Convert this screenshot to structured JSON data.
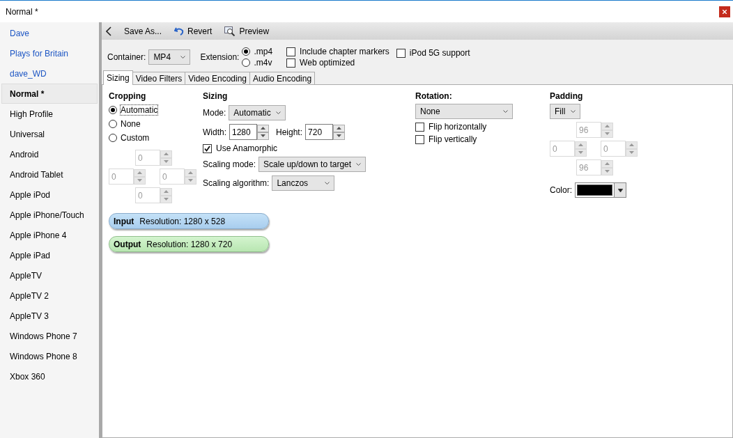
{
  "window": {
    "title": "Normal *"
  },
  "presets": [
    {
      "label": "Dave",
      "kind": "user",
      "selected": false
    },
    {
      "label": "Plays for Britain",
      "kind": "user",
      "selected": false
    },
    {
      "label": "dave_WD",
      "kind": "user",
      "selected": false
    },
    {
      "label": "Normal *",
      "kind": "builtin",
      "selected": true
    },
    {
      "label": "High Profile",
      "kind": "builtin",
      "selected": false
    },
    {
      "label": "Universal",
      "kind": "builtin",
      "selected": false
    },
    {
      "label": "Android",
      "kind": "builtin",
      "selected": false
    },
    {
      "label": "Android Tablet",
      "kind": "builtin",
      "selected": false
    },
    {
      "label": "Apple iPod",
      "kind": "builtin",
      "selected": false
    },
    {
      "label": "Apple iPhone/Touch",
      "kind": "builtin",
      "selected": false
    },
    {
      "label": "Apple iPhone 4",
      "kind": "builtin",
      "selected": false
    },
    {
      "label": "Apple iPad",
      "kind": "builtin",
      "selected": false
    },
    {
      "label": "AppleTV",
      "kind": "builtin",
      "selected": false
    },
    {
      "label": "AppleTV 2",
      "kind": "builtin",
      "selected": false
    },
    {
      "label": "AppleTV 3",
      "kind": "builtin",
      "selected": false
    },
    {
      "label": "Windows Phone 7",
      "kind": "builtin",
      "selected": false
    },
    {
      "label": "Windows Phone 8",
      "kind": "builtin",
      "selected": false
    },
    {
      "label": "Xbox 360",
      "kind": "builtin",
      "selected": false
    }
  ],
  "toolbar": [
    {
      "label": "Save As...",
      "kind": "save"
    },
    {
      "label": "Revert",
      "kind": "revert"
    },
    {
      "label": "Preview",
      "kind": "preview"
    }
  ],
  "container": {
    "label": "Container:",
    "value": "MP4"
  },
  "extension": {
    "label": "Extension:",
    "options": [
      {
        "label": ".mp4",
        "selected": true
      },
      {
        "label": ".m4v",
        "selected": false
      }
    ]
  },
  "options": [
    {
      "label": "Include chapter markers",
      "checked": false
    },
    {
      "label": "Web optimized",
      "checked": false
    },
    {
      "label": "iPod 5G support",
      "checked": false
    }
  ],
  "tabs": [
    {
      "label": "Sizing",
      "selected": true
    },
    {
      "label": "Video Filters",
      "selected": false
    },
    {
      "label": "Video Encoding",
      "selected": false
    },
    {
      "label": "Audio Encoding",
      "selected": false
    }
  ],
  "cropping": {
    "title": "Cropping",
    "options": [
      {
        "label": "Automatic",
        "selected": true
      },
      {
        "label": "None",
        "selected": false
      },
      {
        "label": "Custom",
        "selected": false
      }
    ],
    "top": {
      "value": "0",
      "disabled": true
    },
    "left": {
      "value": "0",
      "disabled": true
    },
    "right": {
      "value": "0",
      "disabled": true
    },
    "bottom": {
      "value": "0",
      "disabled": true
    }
  },
  "sizing": {
    "title": "Sizing",
    "mode_label": "Mode:",
    "mode": "Automatic",
    "width_label": "Width:",
    "width": {
      "value": "1280",
      "disabled": false
    },
    "height_label": "Height:",
    "height": {
      "value": "720",
      "disabled": false
    },
    "anamorphic": {
      "label": "Use Anamorphic",
      "checked": true
    },
    "scaling_mode_label": "Scaling mode:",
    "scaling_mode": "Scale up/down to target",
    "scaling_algorithm_label": "Scaling algorithm:",
    "scaling_algorithm": "Lanczos"
  },
  "rotation": {
    "title": "Rotation:",
    "value": "None",
    "flips": [
      {
        "label": "Flip horizontally",
        "checked": false
      },
      {
        "label": "Flip vertically",
        "checked": false
      }
    ]
  },
  "padding": {
    "title": "Padding",
    "mode": "Fill",
    "top": {
      "value": "96",
      "disabled": true
    },
    "left": {
      "value": "0",
      "disabled": true
    },
    "right": {
      "value": "0",
      "disabled": true
    },
    "bottom": {
      "value": "96",
      "disabled": true
    },
    "color_label": "Color:",
    "color": "#000000"
  },
  "resolutions": [
    {
      "kind": "input",
      "label": "Input",
      "text": "Resolution: 1280 x 528"
    },
    {
      "kind": "output",
      "label": "Output",
      "text": "Resolution: 1280 x 720"
    }
  ]
}
